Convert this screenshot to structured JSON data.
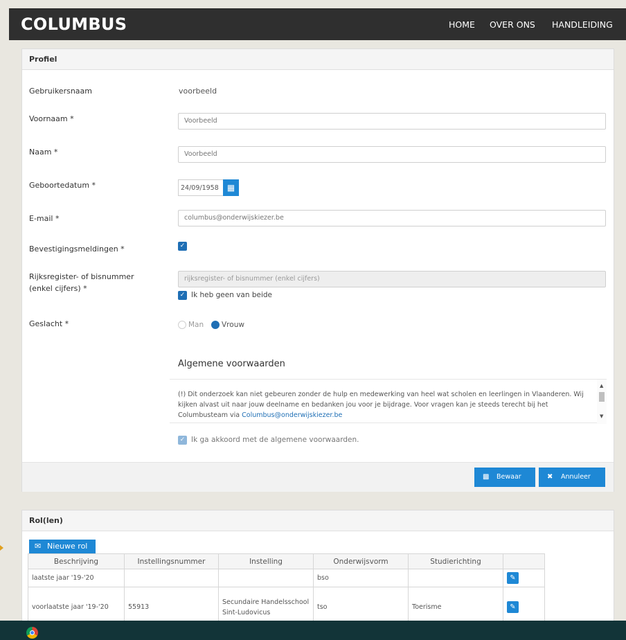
{
  "navbar": {
    "brand": "COLUMBUS",
    "links": [
      "HOME",
      "OVER ONS",
      "HANDLEIDING"
    ]
  },
  "profile": {
    "title": "Profiel",
    "fields": {
      "username_label": "Gebruikersnaam",
      "username_value": "voorbeeld",
      "firstname_label": "Voornaam *",
      "firstname_value": "Voorbeeld",
      "lastname_label": "Naam *",
      "lastname_value": "Voorbeeld",
      "birthdate_label": "Geboortedatum *",
      "birthdate_value": "24/09/1958",
      "email_label": "E-mail *",
      "email_value": "columbus@onderwijskiezer.be",
      "confirmations_label": "Bevestigingsmeldingen *",
      "confirmations_checked": true,
      "register_label_1": "Rijksregister- of bisnummer",
      "register_label_2": "(enkel cijfers) *",
      "register_placeholder": "rijksregister- of bisnummer (enkel cijfers)",
      "none_label": "Ik heb geen van beide",
      "gender_label": "Geslacht *",
      "gender_options": [
        "Man",
        "Vrouw"
      ],
      "gender_selected": "Vrouw"
    },
    "terms": {
      "title": "Algemene voorwaarden",
      "text": "(!) Dit onderzoek kan niet gebeuren zonder de hulp en medewerking van heel wat scholen en leerlingen in Vlaanderen. Wij kijken alvast uit naar jouw deelname en bedanken jou voor je bijdrage. Voor vragen kan je steeds terecht bij het Columbusteam via ",
      "link": "Columbus@onderwijskiezer.be",
      "agree_label": "Ik ga akkoord met de algemene voorwaarden."
    },
    "buttons": {
      "save": "Bewaar",
      "cancel": "Annuleer"
    }
  },
  "roles": {
    "title": "Rol(len)",
    "new_role": "Nieuwe rol",
    "columns": [
      "Beschrijving",
      "Instellingsnummer",
      "Instelling",
      "Onderwijsvorm",
      "Studierichting",
      ""
    ],
    "rows": [
      [
        "laatste jaar '19-'20",
        "",
        "",
        "bso",
        ""
      ],
      [
        "voorlaatste jaar '19-'20",
        "55913",
        "Secundaire Handelsschool Sint-Ludovicus",
        "tso",
        "Toerisme"
      ]
    ]
  },
  "colors": {
    "navbar": "#2f2f2f",
    "accent": "#1e88d5",
    "taskbar": "#123438"
  }
}
